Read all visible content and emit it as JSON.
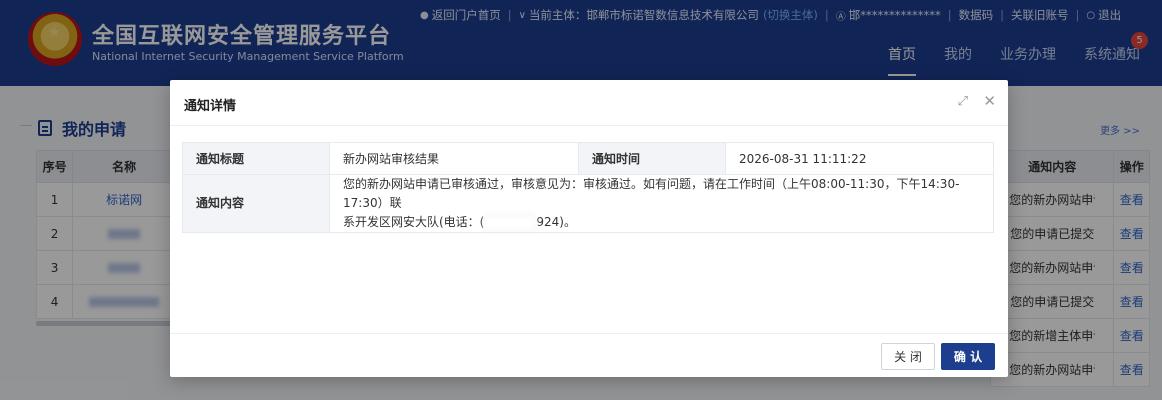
{
  "header": {
    "title": "全国互联网安全管理服务平台",
    "subtitle": "National Internet Security Management Service Platform",
    "topbar": {
      "back_portal": "返回门户首页",
      "current_subject_label": "当前主体：",
      "current_subject": "邯郸市标诺智数信息技术有限公司",
      "switch_subject": "(切换主体)",
      "user": "邯**************",
      "digital_code": "数据码",
      "link_old_account": "关联旧账号",
      "logout": "退出"
    },
    "nav": [
      "首页",
      "我的",
      "业务办理",
      "系统通知"
    ],
    "nav_active": "首页",
    "notification_count": "5"
  },
  "background": {
    "section_title": "我的申请",
    "more_link": "更多 >>",
    "left_table": {
      "columns": [
        "序号",
        "名称"
      ],
      "rows": [
        [
          "1",
          "标诺网"
        ],
        [
          "2",
          ""
        ],
        [
          "3",
          ""
        ],
        [
          "4",
          ""
        ]
      ]
    },
    "right_table": {
      "columns": [
        "通知内容",
        "操作"
      ],
      "rows": [
        [
          "您的新办网站申请",
          "查看"
        ],
        [
          "您的申请已提交",
          "查看"
        ],
        [
          "您的新办网站申请",
          "查看"
        ],
        [
          "您的申请已提交",
          "查看"
        ],
        [
          "您的新增主体申请",
          "查看"
        ],
        [
          "您的新办网站申请",
          "查看"
        ]
      ]
    }
  },
  "modal": {
    "title": "通知详情",
    "fields": {
      "title_label": "通知标题",
      "title_value": "新办网站审核结果",
      "time_label": "通知时间",
      "time_value": "2026-08-31 11:11:22",
      "content_label": "通知内容",
      "content_line1": "您的新办网站申请已审核通过，审核意见为：审核通过。如有问题，请在工作时间（上午08:00-11:30，下午14:30-17:30）联",
      "content_line2_prefix": "系开发区网安大队(电话：(",
      "content_line2_suffix": "924)。"
    },
    "buttons": {
      "close": "关 闭",
      "confirm": "确 认"
    }
  },
  "colors": {
    "primary": "#1d3d8f",
    "link": "#2e64c8",
    "badge": "#e8453c"
  }
}
